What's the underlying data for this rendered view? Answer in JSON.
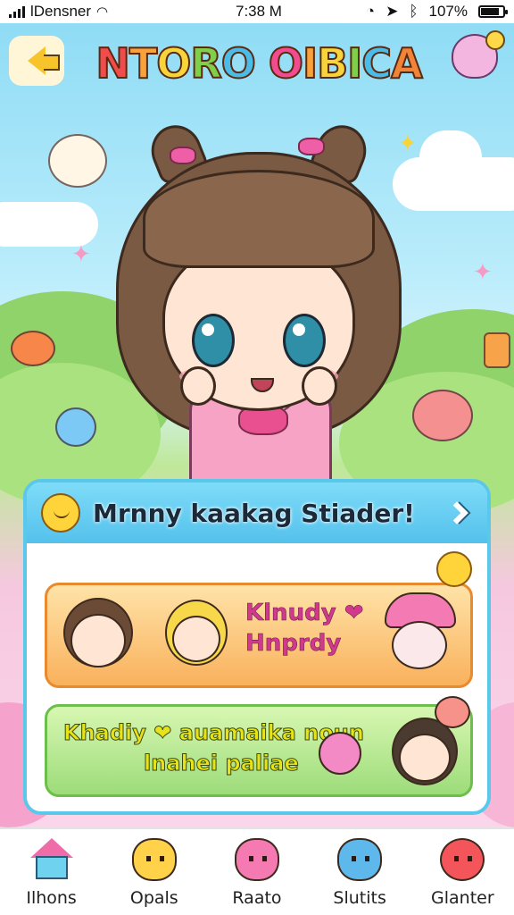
{
  "status_bar": {
    "carrier": "lDensner",
    "time": "7:38 M",
    "battery": "107%"
  },
  "header": {
    "title_chars": [
      {
        "ch": "N",
        "color": "#f24b4b"
      },
      {
        "ch": "T",
        "color": "#f9a13a"
      },
      {
        "ch": "O",
        "color": "#f7d43a"
      },
      {
        "ch": "R",
        "color": "#7fcf4a"
      },
      {
        "ch": "O",
        "color": "#4bbce8"
      },
      {
        "ch": " ",
        "color": "#ffffff"
      },
      {
        "ch": "O",
        "color": "#f24b8e"
      },
      {
        "ch": "I",
        "color": "#f9a13a"
      },
      {
        "ch": "B",
        "color": "#f7d43a"
      },
      {
        "ch": "I",
        "color": "#7fcf4a"
      },
      {
        "ch": "C",
        "color": "#4bbce8"
      },
      {
        "ch": "A",
        "color": "#f2843a"
      }
    ]
  },
  "panel": {
    "title": "Mrnny kaakag Stiader!",
    "cards": [
      {
        "line1": "Klnudy ❤",
        "line2": "Hnprdy"
      },
      {
        "line1": "Khadiy ❤ auamaika noun",
        "line2": "lnahei paliae"
      }
    ]
  },
  "nav": {
    "items": [
      {
        "label": "Ilhons",
        "icon": "home-icon",
        "color": "#6fd2ef"
      },
      {
        "label": "Opals",
        "icon": "bear-icon",
        "color": "#ffd24a"
      },
      {
        "label": "Raato",
        "icon": "pink-cat-icon",
        "color": "#f57ab2"
      },
      {
        "label": "Slutits",
        "icon": "blue-blob-icon",
        "color": "#5fb8ec"
      },
      {
        "label": "Glanter",
        "icon": "apple-icon",
        "color": "#f4555a"
      }
    ]
  }
}
